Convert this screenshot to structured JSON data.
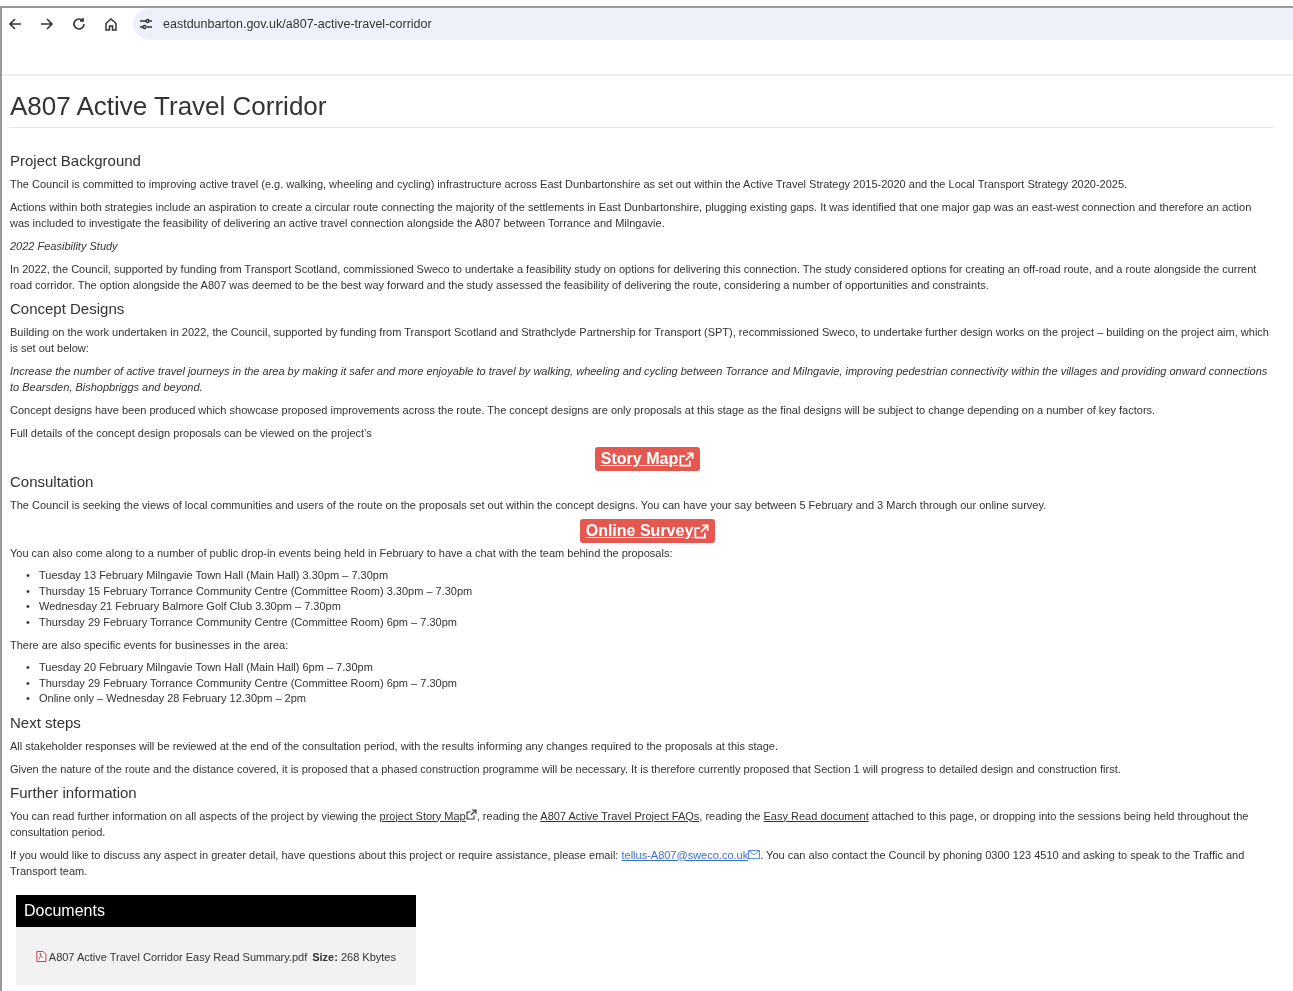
{
  "browser": {
    "url": "eastdunbarton.gov.uk/a807-active-travel-corridor"
  },
  "page": {
    "title": "A807 Active Travel Corridor"
  },
  "sections": [
    {
      "heading": "Project Background",
      "blocks": [
        {
          "kind": "paragraph",
          "text": "The Council is committed to improving active travel (e.g. walking, wheeling and cycling) infrastructure across East Dunbartonshire as set out within the Active Travel Strategy 2015-2020 and the Local Transport Strategy 2020-2025."
        },
        {
          "kind": "paragraph",
          "text": "Actions within both strategies include an aspiration to create a circular route connecting the majority of the settlements in East Dunbartonshire, plugging existing gaps. It was identified that one major gap was an east-west connection and therefore an action was included to investigate the feasibility of delivering an active travel connection alongside the A807 between Torrance and Milngavie."
        },
        {
          "kind": "italic",
          "text": "2022 Feasibility Study"
        },
        {
          "kind": "paragraph",
          "text": "In 2022, the Council, supported by funding from Transport Scotland, commissioned Sweco to undertake a feasibility study on options for delivering this connection. The study considered options for creating an off-road route, and a route alongside the current road corridor. The option alongside the A807 was deemed to be the best way forward and the study assessed the feasibility of delivering the route, considering a number of opportunities and constraints."
        }
      ]
    },
    {
      "heading": "Concept Designs",
      "blocks": [
        {
          "kind": "paragraph",
          "text": "Building on the work undertaken in 2022, the Council, supported by funding from Transport Scotland and Strathclyde Partnership for Transport (SPT), recommissioned Sweco, to undertake further design works on the project – building on the project aim, which is set out below:"
        },
        {
          "kind": "italic",
          "text": "Increase the number of active travel journeys in the area by making it safer and more enjoyable to travel by walking, wheeling and cycling between Torrance and Milngavie, improving pedestrian connectivity within the villages and providing onward connections to Bearsden, Bishopbriggs and beyond."
        },
        {
          "kind": "paragraph",
          "text": "Concept designs have been produced which showcase proposed improvements across the route. The concept designs are only proposals at this stage as the final designs will be subject to change depending on a number of key factors."
        },
        {
          "kind": "paragraph",
          "text": "Full details of the concept design proposals can be viewed on the project’s"
        },
        {
          "kind": "button",
          "text": "Story Map"
        }
      ]
    },
    {
      "heading": "Consultation",
      "blocks": [
        {
          "kind": "paragraph",
          "text": "The Council is seeking the views of local communities and users of the route on the proposals set out within the concept designs. You can have your say between 5 February and 3 March through our online survey."
        },
        {
          "kind": "button",
          "text": "Online Survey"
        },
        {
          "kind": "paragraph",
          "text": "You can also come along to a number of public drop-in events being held in February to have a chat with the team behind the proposals:"
        },
        {
          "kind": "list",
          "items": [
            {
              "bullet": "•",
              "text": "Tuesday 13 February Milngavie Town Hall (Main Hall) 3.30pm – 7.30pm"
            },
            {
              "bullet": "•",
              "text": "Thursday 15 February Torrance Community Centre (Committee Room) 3.30pm – 7.30pm"
            },
            {
              "bullet": "•",
              "text": "Wednesday 21 February Balmore Golf Club 3.30pm – 7.30pm"
            },
            {
              "bullet": "•",
              "text": "Thursday 29 February Torrance Community Centre (Committee Room) 6pm – 7.30pm"
            }
          ]
        },
        {
          "kind": "paragraph",
          "text": "There are also specific events for businesses in the area:"
        },
        {
          "kind": "list",
          "items": [
            {
              "bullet": "•",
              "text": "Tuesday 20 February Milngavie Town Hall (Main Hall) 6pm – 7.30pm"
            },
            {
              "bullet": "•",
              "text": "Thursday 29 February Torrance Community Centre (Committee Room) 6pm – 7.30pm"
            },
            {
              "bullet": "•",
              "text": "Online only – Wednesday 28 February 12.30pm – 2pm"
            }
          ]
        }
      ]
    },
    {
      "heading": "Next steps",
      "blocks": [
        {
          "kind": "paragraph",
          "text": "All stakeholder responses will be reviewed at the end of the consultation period, with the results informing any changes required to the proposals at this stage."
        },
        {
          "kind": "paragraph",
          "text": "Given the nature of the route and the distance covered, it is proposed that a phased construction programme will be necessary. It is therefore currently proposed that Section 1 will progress to detailed design and construction first."
        }
      ]
    },
    {
      "heading": "Further information",
      "blocks": [
        {
          "kind": "rich",
          "parts": [
            {
              "kind": "text",
              "text": "You can read further information on all aspects of the project by viewing the "
            },
            {
              "kind": "external_link",
              "text": "project Story Map"
            },
            {
              "kind": "text",
              "text": ", reading the "
            },
            {
              "kind": "link",
              "text": "A807 Active Travel Project FAQs"
            },
            {
              "kind": "text",
              "text": ", reading the "
            },
            {
              "kind": "link",
              "text": "Easy Read document"
            },
            {
              "kind": "text",
              "text": " attached to this page, or dropping into the sessions being held throughout the consultation period."
            }
          ]
        },
        {
          "kind": "rich",
          "parts": [
            {
              "kind": "text",
              "text": "If you would like to discuss any aspect in greater detail, have questions about this project or require assistance, please email: "
            },
            {
              "kind": "email_link",
              "text": "tellus-A807@sweco.co.uk"
            },
            {
              "kind": "text",
              "text": ". You can also contact the Council by phoning 0300 123 4510 and asking to speak to the Traffic and Transport team."
            }
          ]
        }
      ]
    }
  ],
  "documents": {
    "title": "Documents",
    "files": [
      {
        "name": "A807 Active Travel Corridor Easy Read Summary.pdf",
        "size_label": "Size:",
        "size": "268 Kbytes"
      }
    ]
  }
}
